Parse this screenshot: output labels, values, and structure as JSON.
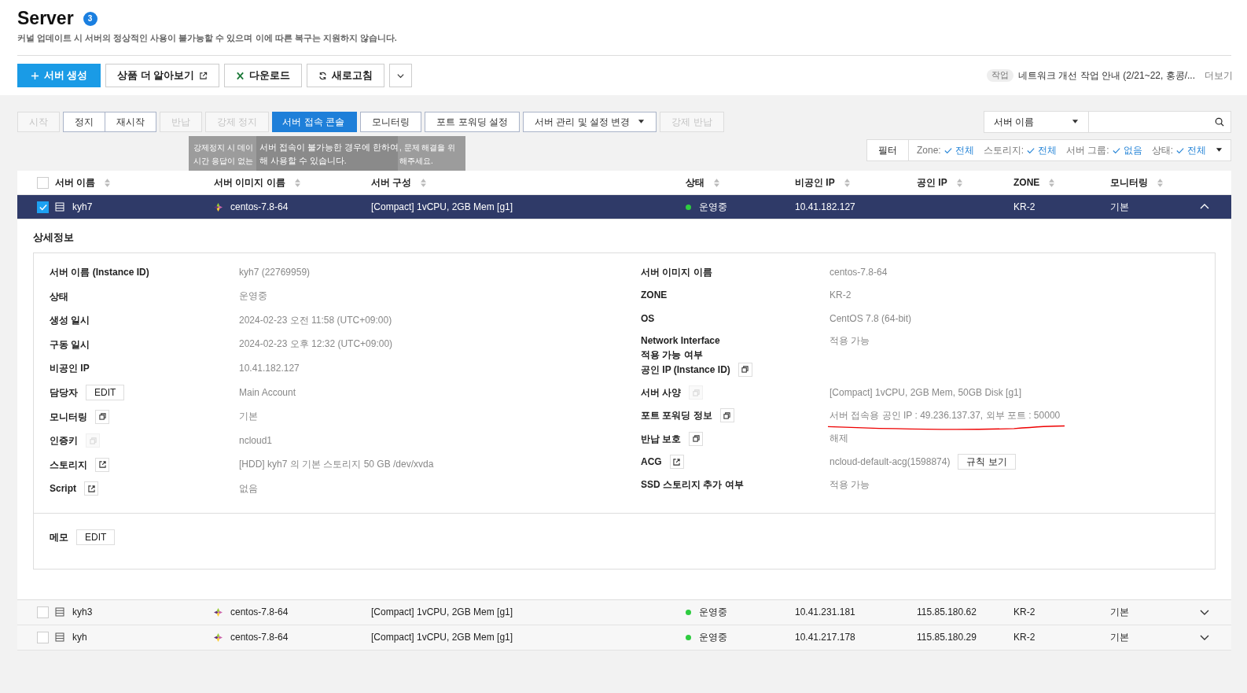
{
  "header": {
    "title": "Server",
    "count": "3",
    "notice": "커널 업데이트 시 서버의 정상적인 사용이 불가능할 수 있으며 이에 따른 복구는 지원하지 않습니다."
  },
  "toolbar": [
    {
      "label": "서버 생성",
      "kind": "create"
    },
    {
      "label": "상품 더 알아보기",
      "kind": "external"
    },
    {
      "label": "다운로드",
      "kind": "excel"
    },
    {
      "label": "새로고침",
      "kind": "refresh"
    },
    {
      "kind": "more"
    }
  ],
  "announcement": {
    "tag": "작업",
    "text": "네트워크 개선 작업 안내 (2/21~22, 홍콩/...",
    "more": "더보기"
  },
  "actions": [
    {
      "label": "시작",
      "disabled": true,
      "selected": false,
      "menu": false
    },
    {
      "label": "정지",
      "disabled": false,
      "selected": false,
      "menu": false
    },
    {
      "label": "재시작",
      "disabled": false,
      "selected": false,
      "menu": false
    },
    {
      "label": "반납",
      "disabled": true,
      "selected": false,
      "menu": false
    },
    {
      "label": "강제 정지",
      "disabled": true,
      "selected": false,
      "menu": false
    },
    {
      "label": "서버 접속 콘솔",
      "disabled": false,
      "selected": true,
      "menu": false
    },
    {
      "label": "모니터링",
      "disabled": false,
      "selected": false,
      "menu": false
    },
    {
      "label": "포트 포워딩 설정",
      "disabled": false,
      "selected": false,
      "menu": false
    },
    {
      "label": "서버 관리 및 설정 변경",
      "disabled": false,
      "selected": false,
      "menu": true
    },
    {
      "label": "강제 반납",
      "disabled": true,
      "selected": false,
      "menu": false
    }
  ],
  "tooltips": [
    {
      "left": [
        "강제정지 시 데이",
        "시간 응답이 없는"
      ],
      "right": [
        ", 문제 해결을 위",
        "해주세요."
      ]
    },
    {
      "lines": [
        "서버 접속이 불가능한 경우에 한하여",
        "해 사용할 수 있습니다."
      ]
    }
  ],
  "search": {
    "select": "서버 이름"
  },
  "filter": {
    "label": "필터",
    "items": [
      {
        "key": "Zone:",
        "value": "전체"
      },
      {
        "key": "스토리지:",
        "value": "전체"
      },
      {
        "key": "서버 그룹:",
        "value": "없음"
      },
      {
        "key": "상태:",
        "value": "전체"
      }
    ]
  },
  "table": {
    "all_checked": false,
    "columns": [
      "서버 이름",
      "서버 이미지 이름",
      "서버 구성",
      "상태",
      "비공인 IP",
      "공인 IP",
      "ZONE",
      "모니터링"
    ],
    "rows": [
      {
        "name": "kyh7",
        "image": "centos-7.8-64",
        "spec": "[Compact] 1vCPU, 2GB Mem [g1]",
        "status": "운영중",
        "color": "#2ecc40",
        "private_ip": "10.41.182.127",
        "zone": "KR-2",
        "monitoring": "기본",
        "checked": true,
        "selected": true,
        "expanded": true
      },
      {
        "name": "kyh3",
        "image": "centos-7.8-64",
        "spec": "[Compact] 1vCPU, 2GB Mem [g1]",
        "status": "운영중",
        "color": "#2ecc40",
        "private_ip": "10.41.231.181",
        "public_ip": "115.85.180.62",
        "zone": "KR-2",
        "monitoring": "기본",
        "checked": false,
        "selected": false,
        "expanded": false
      },
      {
        "name": "kyh",
        "image": "centos-7.8-64",
        "spec": "[Compact] 1vCPU, 2GB Mem [g1]",
        "status": "운영중",
        "color": "#2ecc40",
        "private_ip": "10.41.217.178",
        "public_ip": "115.85.180.29",
        "zone": "KR-2",
        "monitoring": "기본",
        "checked": false,
        "selected": false,
        "expanded": false
      }
    ]
  },
  "detail": {
    "title": "상세정보",
    "left": [
      {
        "label": "서버 이름 (Instance ID)",
        "value": "kyh7 (22769959)",
        "kind": "plain"
      },
      {
        "label": "상태",
        "value": "운영중",
        "kind": "plain"
      },
      {
        "label": "생성 일시",
        "value": "2024-02-23 오전 11:58 (UTC+09:00)",
        "kind": "plain"
      },
      {
        "label": "구동 일시",
        "value": "2024-02-23 오후 12:32 (UTC+09:00)",
        "kind": "plain"
      },
      {
        "label": "비공인 IP",
        "value": "10.41.182.127",
        "kind": "plain"
      },
      {
        "label": "담당자",
        "value": "Main Account",
        "kind": "edit",
        "action_label": "EDIT"
      },
      {
        "label": "모니터링",
        "value": "기본",
        "kind": "copy",
        "disabled": false
      },
      {
        "label": "인증키",
        "value": "ncloud1",
        "kind": "copy",
        "disabled": true
      },
      {
        "label": "스토리지",
        "value": "[HDD] kyh7 의 기본 스토리지  50 GB /dev/xvda",
        "kind": "link"
      },
      {
        "label": "Script",
        "value": "없음",
        "kind": "link"
      }
    ],
    "right": [
      {
        "label": "서버 이미지 이름",
        "value": "centos-7.8-64",
        "kind": "plain"
      },
      {
        "label": "ZONE",
        "value": "KR-2",
        "kind": "plain"
      },
      {
        "label": "OS",
        "value": "CentOS 7.8 (64-bit)",
        "kind": "plain"
      },
      {
        "label": "Network Interface\n적용 가능 여부",
        "value": "적용 가능",
        "kind": "plain"
      },
      {
        "label": "공인 IP (Instance ID)",
        "kind": "copy",
        "disabled": false
      },
      {
        "label": "서버 사양",
        "value": "[Compact] 1vCPU, 2GB Mem, 50GB Disk [g1]",
        "kind": "copy",
        "disabled": true
      },
      {
        "label": "포트 포워딩 정보",
        "value": "서버 접속용 공인 IP : 49.236.137.37, 외부 포트 : 50000",
        "kind": "copy",
        "disabled": false,
        "underlined": true
      },
      {
        "label": "반납 보호",
        "value": "해제",
        "kind": "copy",
        "disabled": false
      },
      {
        "label": "ACG",
        "value": "ncloud-default-acg(1598874)",
        "kind": "link",
        "button": "규칙 보기"
      },
      {
        "label": "SSD 스토리지 추가 여부",
        "value": "적용 가능",
        "kind": "plain"
      }
    ],
    "memo": {
      "label": "메모",
      "action_label": "EDIT"
    }
  }
}
